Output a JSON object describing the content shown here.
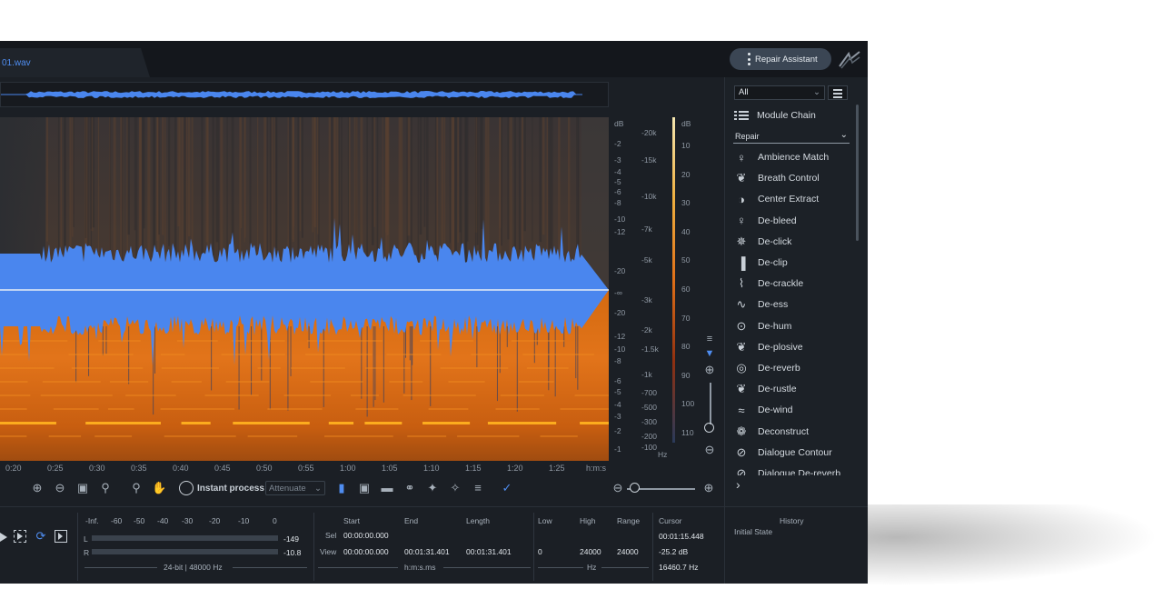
{
  "file_tab": {
    "label": "01.wav"
  },
  "header": {
    "repair_assistant_label": "Repair Assistant"
  },
  "time_axis": {
    "ticks": [
      "0:20",
      "0:25",
      "0:30",
      "0:35",
      "0:40",
      "0:45",
      "0:50",
      "0:55",
      "1:00",
      "1:05",
      "1:10",
      "1:15",
      "1:20",
      "1:25"
    ],
    "unit": "h:m:s"
  },
  "db_axis": {
    "unit": "dB",
    "ticks": [
      "-2",
      "-3",
      "-4",
      "-5",
      "-6",
      "-8",
      "-10",
      "-12",
      "-20",
      "-∞",
      "-20",
      "-12",
      "-10",
      "-8",
      "-6",
      "-5",
      "-4",
      "-3",
      "-2",
      "-1"
    ]
  },
  "hz_axis": {
    "unit": "Hz",
    "ticks": [
      "-20k",
      "-15k",
      "-10k",
      "-7k",
      "-5k",
      "-3k",
      "-2k",
      "-1.5k",
      "-1k",
      "-700",
      "-500",
      "-300",
      "-200",
      "-100"
    ]
  },
  "meter_axis": {
    "unit": "dB",
    "ticks": [
      "10",
      "20",
      "30",
      "40",
      "50",
      "60",
      "70",
      "80",
      "90",
      "100",
      "110"
    ]
  },
  "toolbar": {
    "instant_process_label": "Instant process",
    "mode_value": "Attenuate"
  },
  "panel": {
    "filter_value": "All",
    "module_chain_label": "Module Chain",
    "category_value": "Repair",
    "modules": [
      "Ambience Match",
      "Breath Control",
      "Center Extract",
      "De-bleed",
      "De-click",
      "De-clip",
      "De-crackle",
      "De-ess",
      "De-hum",
      "De-plosive",
      "De-reverb",
      "De-rustle",
      "De-wind",
      "Deconstruct",
      "Dialogue Contour",
      "Dialogue De-reverb"
    ]
  },
  "meters": {
    "scale": [
      "-Inf.",
      "-60",
      "-50",
      "-40",
      "-30",
      "-20",
      "-10",
      "0"
    ],
    "left_label": "L",
    "right_label": "R",
    "left_peak": "-149",
    "right_peak": "-10.8",
    "format": "24-bit | 48000 Hz"
  },
  "selection": {
    "headers": {
      "start": "Start",
      "end": "End",
      "length": "Length",
      "low": "Low",
      "high": "High",
      "range": "Range",
      "cursor": "Cursor"
    },
    "sel_label": "Sel",
    "view_label": "View",
    "sel_start": "00:00:00.000",
    "view_start": "00:00:00.000",
    "view_end": "00:01:31.401",
    "view_length": "00:01:31.401",
    "view_low": "0",
    "view_high": "24000",
    "view_range": "24000",
    "time_unit": "h:m:s.ms",
    "freq_unit": "Hz",
    "cursor_time": "00:01:15.448",
    "cursor_db": "-25.2 dB",
    "cursor_hz": "16460.7 Hz"
  },
  "history": {
    "title": "History",
    "items": [
      "Initial State"
    ]
  },
  "colors": {
    "accent": "#4f8df0",
    "waveform": "#4a86ee",
    "spectrogram_hot": "#ff8a1a",
    "background": "#1b1f25"
  }
}
